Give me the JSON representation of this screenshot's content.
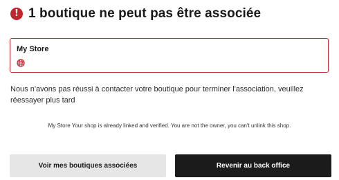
{
  "header": {
    "icon": "exclamation-circle-icon",
    "icon_glyph": "!",
    "title": "1 boutique ne peut pas être associée"
  },
  "store": {
    "name": "My Store",
    "icon": "globe-icon"
  },
  "message": "Nous n'avons pas réussi à contacter votre boutique pour terminer l'association, veuillez réessayer plus tard",
  "note": "My Store Your shop is already linked and verified. You are not the owner, you can't unlink this shop.",
  "actions": {
    "secondary_label": "Voir mes boutiques associées",
    "primary_label": "Revenir au back office"
  },
  "colors": {
    "error": "#c0272d",
    "primary_button": "#1b1b1b",
    "secondary_button": "#e6e6e6"
  }
}
